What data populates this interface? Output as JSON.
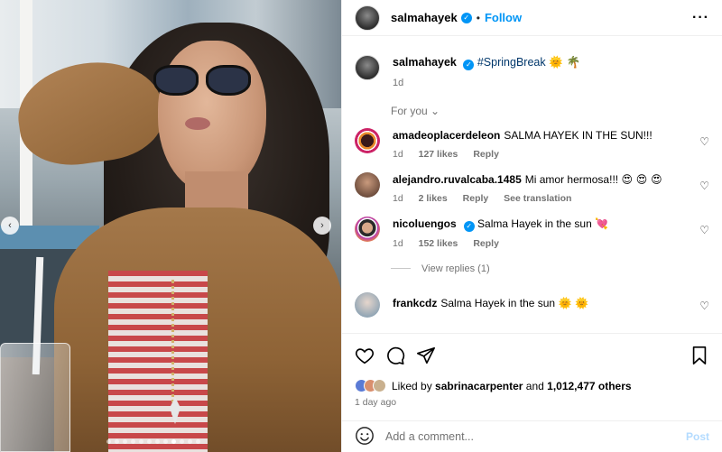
{
  "header": {
    "username": "salmahayek",
    "separator": "•",
    "follow_label": "Follow",
    "more_label": "···"
  },
  "caption": {
    "username": "salmahayek",
    "hashtag": "#SpringBreak",
    "emojis": "🌞 🌴",
    "time": "1d"
  },
  "for_you_label": "For you ⌄",
  "comments": [
    {
      "username": "amadeoplacerdeleon",
      "text": "SALMA HAYEK IN THE SUN!!!",
      "emoji": "",
      "time": "1d",
      "likes": "127 likes",
      "reply": "Reply",
      "translate": ""
    },
    {
      "username": "alejandro.ruvalcaba.1485",
      "text": "Mi amor hermosa!!!",
      "emoji": "😍 😍 😍",
      "time": "1d",
      "likes": "2 likes",
      "reply": "Reply",
      "translate": "See translation"
    },
    {
      "username": "nicoluengos",
      "text": "Salma Hayek in the sun",
      "emoji": "💘",
      "time": "1d",
      "likes": "152 likes",
      "reply": "Reply",
      "translate": ""
    },
    {
      "username": "frankcdz",
      "text": "Salma Hayek in the sun",
      "emoji": "🌞 🌞",
      "time": "",
      "likes": "",
      "reply": "",
      "translate": ""
    }
  ],
  "view_replies_label": "View replies (1)",
  "likes": {
    "prefix": "Liked by",
    "user": "sabrinacarpenter",
    "middle": "and",
    "count": "1,012,477 others"
  },
  "post_age": "1 day ago",
  "add_comment": {
    "placeholder": "Add a comment...",
    "post_label": "Post"
  },
  "carousel": {
    "prev_icon": "chevron-left-icon",
    "next_icon": "chevron-right-icon",
    "slide_count": 12,
    "active_slide": 8
  },
  "colors": {
    "accent": "#0095f6",
    "muted": "#737373",
    "hashtag": "#00376b",
    "post_disabled": "#b3dbff"
  }
}
